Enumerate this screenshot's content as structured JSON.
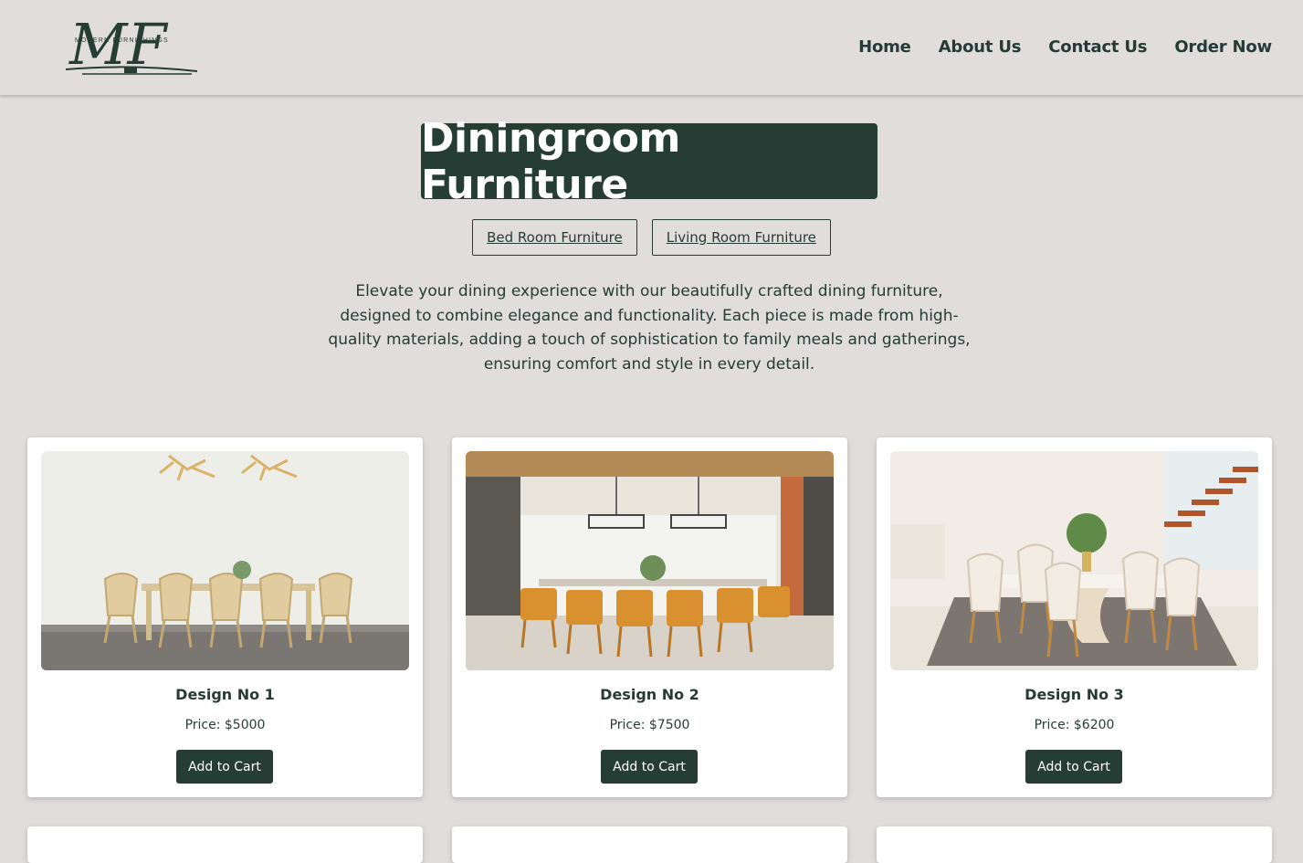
{
  "brand": {
    "logo_letters": "MF",
    "logo_tagline": "MODERN FURNISHINGS"
  },
  "nav": {
    "items": [
      {
        "label": "Home"
      },
      {
        "label": "About Us"
      },
      {
        "label": "Contact Us"
      },
      {
        "label": "Order Now"
      }
    ]
  },
  "page": {
    "title": "Diningroom Furniture",
    "category_links": [
      {
        "label": "Bed Room Furniture"
      },
      {
        "label": "Living Room Furniture"
      }
    ],
    "intro": "Elevate your dining experience with our beautifully crafted dining furniture, designed to combine elegance and functionality. Each piece is made from high-quality materials, adding a touch of sophistication to family meals and gatherings, ensuring comfort and style in every detail."
  },
  "products": [
    {
      "name": "Design No 1",
      "price": "Price: $5000",
      "button": "Add to Cart"
    },
    {
      "name": "Design No 2",
      "price": "Price: $7500",
      "button": "Add to Cart"
    },
    {
      "name": "Design No 3",
      "price": "Price: $6200",
      "button": "Add to Cart"
    }
  ],
  "colors": {
    "background": "#e0dddc",
    "primary": "#263d36",
    "card": "#ffffff"
  }
}
